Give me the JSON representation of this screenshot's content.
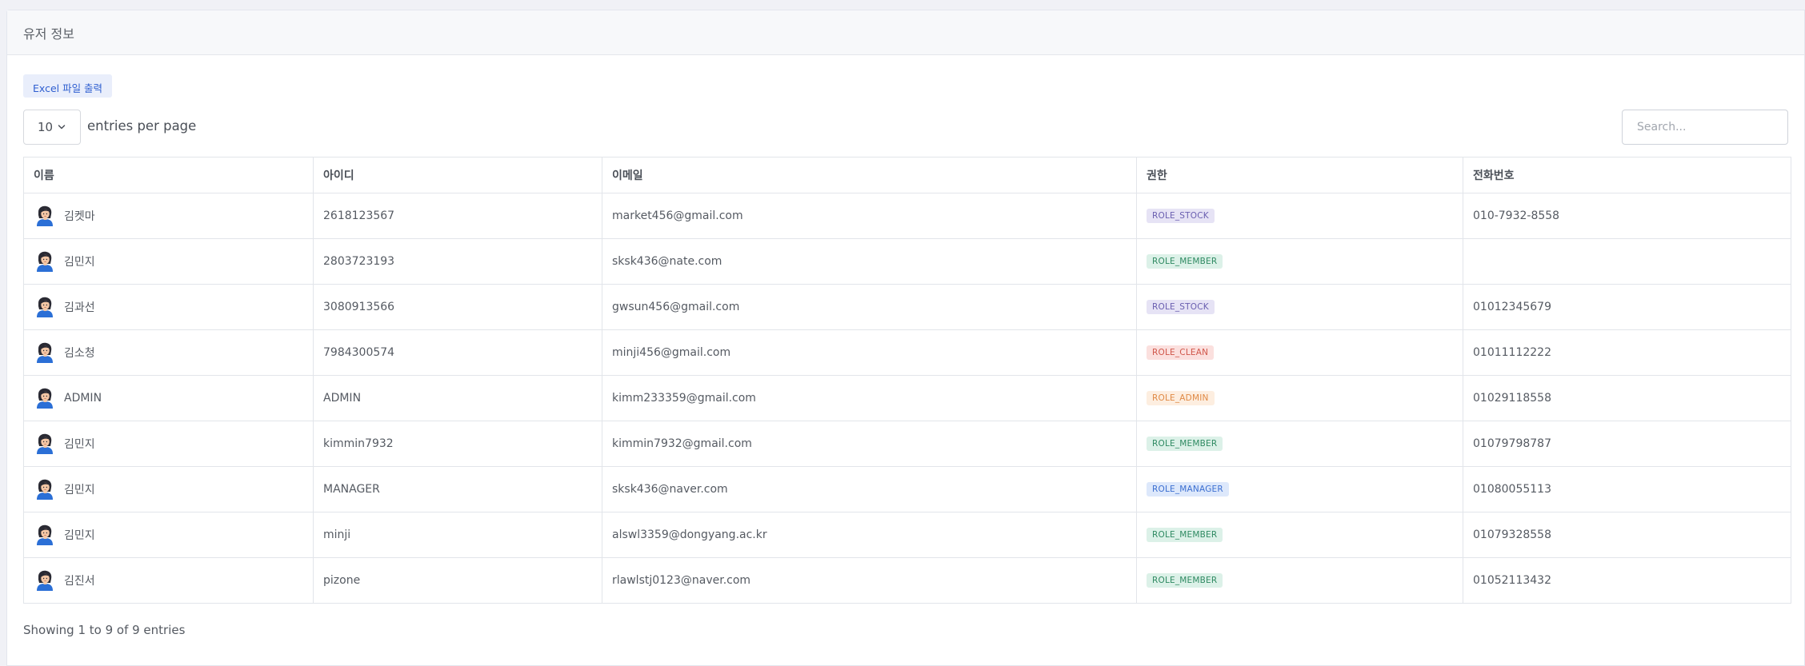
{
  "header": {
    "title": "유저 정보"
  },
  "toolbar": {
    "excel_label": "Excel 파일 출력"
  },
  "controls": {
    "per_page_value": "10",
    "per_page_label": "entries per page",
    "search_placeholder": "Search..."
  },
  "table": {
    "columns": [
      "이름",
      "아이디",
      "이메일",
      "권한",
      "전화번호"
    ],
    "rows": [
      {
        "name": "김켓마",
        "id": "2618123567",
        "email": "market456@gmail.com",
        "role": "ROLE_STOCK",
        "phone": "010-7932-8558"
      },
      {
        "name": "김민지",
        "id": "2803723193",
        "email": "sksk436@nate.com",
        "role": "ROLE_MEMBER",
        "phone": ""
      },
      {
        "name": "김과선",
        "id": "3080913566",
        "email": "gwsun456@gmail.com",
        "role": "ROLE_STOCK",
        "phone": "01012345679"
      },
      {
        "name": "김소청",
        "id": "7984300574",
        "email": "minji456@gmail.com",
        "role": "ROLE_CLEAN",
        "phone": "01011112222"
      },
      {
        "name": "ADMIN",
        "id": "ADMIN",
        "email": "kimm233359@gmail.com",
        "role": "ROLE_ADMIN",
        "phone": "01029118558"
      },
      {
        "name": "김민지",
        "id": "kimmin7932",
        "email": "kimmin7932@gmail.com",
        "role": "ROLE_MEMBER",
        "phone": "01079798787"
      },
      {
        "name": "김민지",
        "id": "MANAGER",
        "email": "sksk436@naver.com",
        "role": "ROLE_MANAGER",
        "phone": "01080055113"
      },
      {
        "name": "김민지",
        "id": "minji",
        "email": "alswl3359@dongyang.ac.kr",
        "role": "ROLE_MEMBER",
        "phone": "01079328558"
      },
      {
        "name": "김진서",
        "id": "pizone",
        "email": "rlawlstj0123@naver.com",
        "role": "ROLE_MEMBER",
        "phone": "01052113432"
      }
    ]
  },
  "role_colors": {
    "ROLE_STOCK": {
      "bg": "#e6e3f5",
      "fg": "#6a5fb0"
    },
    "ROLE_MEMBER": {
      "bg": "#dcf1e8",
      "fg": "#2f8a62"
    },
    "ROLE_CLEAN": {
      "bg": "#fbe0de",
      "fg": "#d0564a"
    },
    "ROLE_ADMIN": {
      "bg": "#fdeee0",
      "fg": "#e08a45"
    },
    "ROLE_MANAGER": {
      "bg": "#dde8fb",
      "fg": "#3c6fd1"
    }
  },
  "avatar_icon": "user-avatar-icon",
  "footer": {
    "info": "Showing 1 to 9 of 9 entries"
  }
}
